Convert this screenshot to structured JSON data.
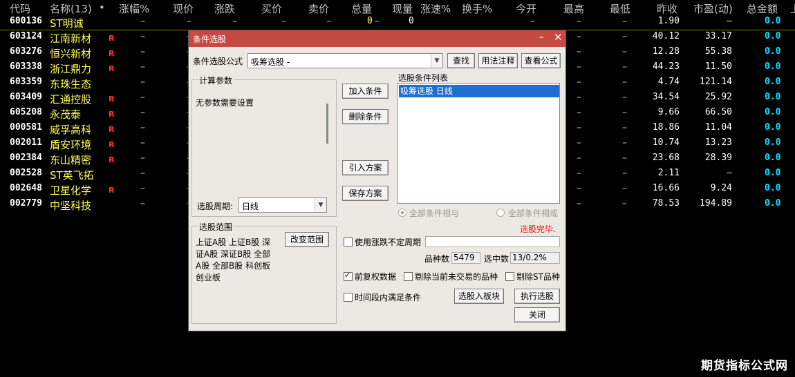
{
  "table": {
    "headers": [
      "代码",
      "名称(13)",
      "•",
      "涨幅%",
      "现价",
      "涨跌",
      "买价",
      "卖价",
      "总量",
      "现量",
      "涨速%",
      "换手%",
      "今开",
      "最高",
      "最低",
      "昨收",
      "市盈(动)",
      "总金额",
      "上"
    ],
    "rows": [
      {
        "code": "600136",
        "name": "ST明诚",
        "r": "",
        "pre_close": "1.90",
        "pe": "–",
        "amount": "0.0",
        "total_vol": "0",
        "cur_vol": "0"
      },
      {
        "code": "603124",
        "name": "江南新材",
        "r": "R",
        "pre_close": "40.12",
        "pe": "33.17",
        "amount": "0.0"
      },
      {
        "code": "603276",
        "name": "恒兴新材",
        "r": "R",
        "pre_close": "12.28",
        "pe": "55.38",
        "amount": "0.0"
      },
      {
        "code": "603338",
        "name": "浙江鼎力",
        "r": "R",
        "pre_close": "44.23",
        "pe": "11.50",
        "amount": "0.0"
      },
      {
        "code": "603359",
        "name": "东珠生态",
        "r": "",
        "pre_close": "4.74",
        "pe": "121.14",
        "amount": "0.0"
      },
      {
        "code": "603409",
        "name": "汇通控股",
        "r": "R",
        "pre_close": "34.54",
        "pe": "25.92",
        "amount": "0.0"
      },
      {
        "code": "605208",
        "name": "永茂泰",
        "r": "R",
        "pre_close": "9.66",
        "pe": "66.50",
        "amount": "0.0"
      },
      {
        "code": "000581",
        "name": "威孚高科",
        "r": "R",
        "pre_close": "18.86",
        "pe": "11.04",
        "amount": "0.0"
      },
      {
        "code": "002011",
        "name": "盾安环境",
        "r": "R",
        "pre_close": "10.74",
        "pe": "13.23",
        "amount": "0.0"
      },
      {
        "code": "002384",
        "name": "东山精密",
        "r": "R",
        "pre_close": "23.68",
        "pe": "28.39",
        "amount": "0.0"
      },
      {
        "code": "002528",
        "name": "ST英飞拓",
        "r": "",
        "pre_close": "2.11",
        "pe": "–",
        "amount": "0.0"
      },
      {
        "code": "002648",
        "name": "卫星化学",
        "r": "R",
        "pre_close": "16.66",
        "pe": "9.24",
        "amount": "0.0"
      },
      {
        "code": "002779",
        "name": "中坚科技",
        "r": "",
        "pre_close": "78.53",
        "pe": "194.89",
        "amount": "0.0"
      }
    ],
    "dash": "–"
  },
  "dialog": {
    "title": "条件选股",
    "min_icon": "minimize-icon",
    "close_icon": "close-icon",
    "formula_label": "条件选股公式",
    "formula_value": "吸筹选股    -",
    "find_btn": "查找",
    "usage_btn": "用法注释",
    "view_btn": "查看公式",
    "calc_params_label": "计算参数",
    "no_params": "无参数需要设置",
    "period_label": "选股周期:",
    "period_value": "日线",
    "add_cond": "加入条件",
    "del_cond": "删除条件",
    "import_plan": "引入方案",
    "save_plan": "保存方案",
    "cond_list_label": "选股条件列表",
    "cond_item": "吸筹选股  日线",
    "all_and": "全部条件相与",
    "all_or": "全部条件相或",
    "status": "选股完毕.",
    "range_label": "选股范围",
    "range_text": [
      "上证A股 上证B股 深",
      "证A股 深证B股 全部",
      "A股 全部B股 科创板",
      "创业板"
    ],
    "change_range": "改变范围",
    "use_period": "使用涨跌不定周期",
    "count_label": "品种数",
    "count_value": "5479",
    "selected_label": "选中数",
    "selected_value": "13/0.2%",
    "pre_adjust": "前复权数据",
    "exclude_untraded": "剔除当前未交易的品种",
    "exclude_st": "剔除ST品种",
    "time_range": "时间段内满足条件",
    "to_board": "选股入板块",
    "run": "执行选股",
    "close": "关闭"
  },
  "watermark": "期货指标公式网",
  "colors": {
    "title_bar": "#c64a42",
    "selected_row": "#1f6fd0",
    "name_text": "#ffff55",
    "amount_text": "#00e0ff",
    "status_text": "#e02020"
  }
}
